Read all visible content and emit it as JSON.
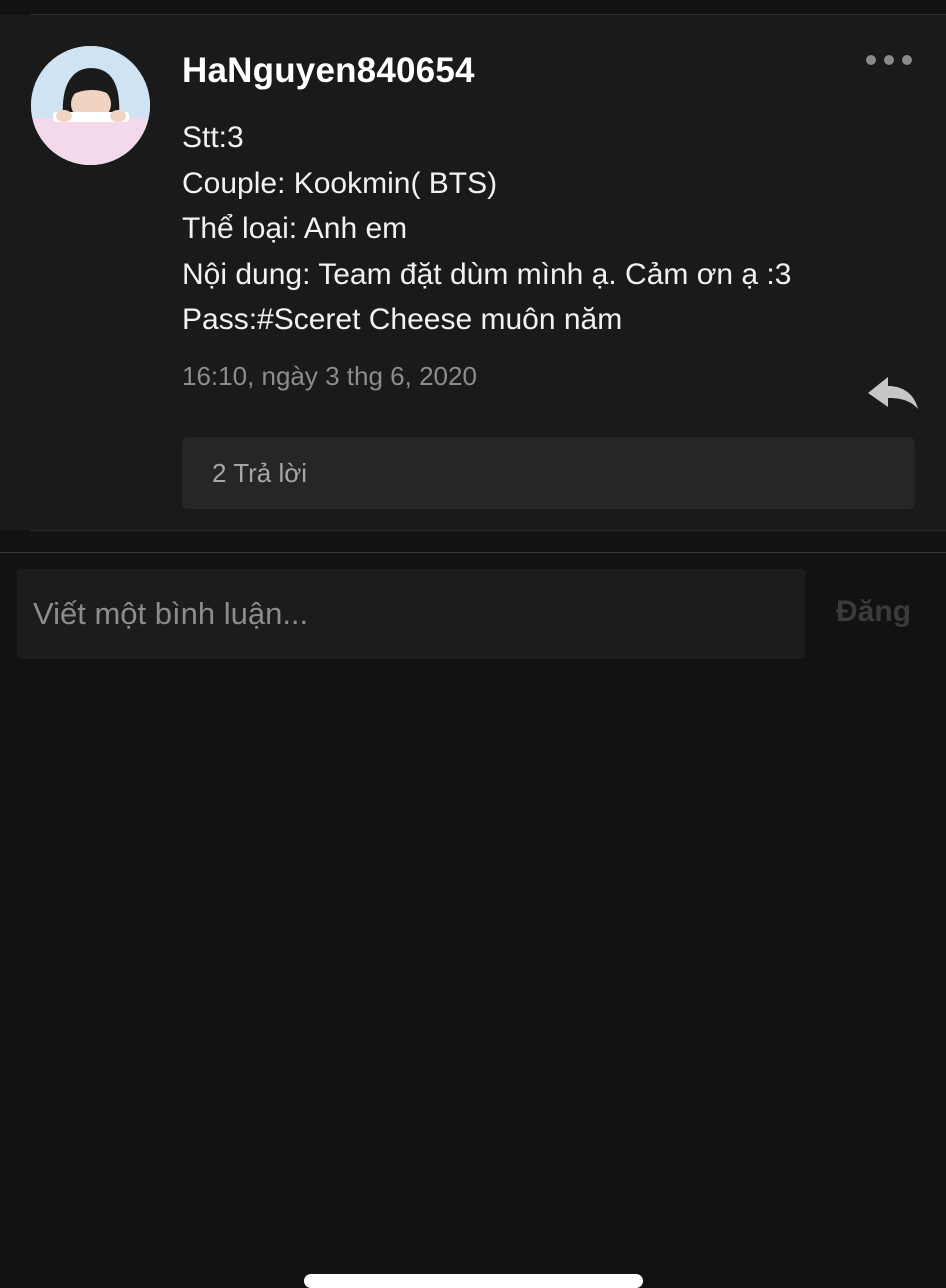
{
  "comment": {
    "author": "HaNguyen840654",
    "lines": [
      "Stt:3",
      "Couple: Kookmin( BTS)",
      "Thể loại: Anh em",
      "Nội dung: Team đặt dùm mình ạ. Cảm ơn ạ :3",
      "Pass:#Sceret Cheese muôn năm"
    ],
    "timestamp": "16:10, ngày 3 thg 6, 2020",
    "replies_label": "2 Trả lời",
    "icons": {
      "more": "more-horizontal-icon",
      "reply": "reply-arrow-icon"
    }
  },
  "composer": {
    "placeholder": "Viết một bình luận...",
    "post_label": "Đăng"
  },
  "colors": {
    "background": "#121212",
    "comment_background": "#1a1a1a",
    "replies_box": "#262626",
    "muted_text": "#8c8c8c",
    "disabled_button": "#3b3b3b"
  }
}
